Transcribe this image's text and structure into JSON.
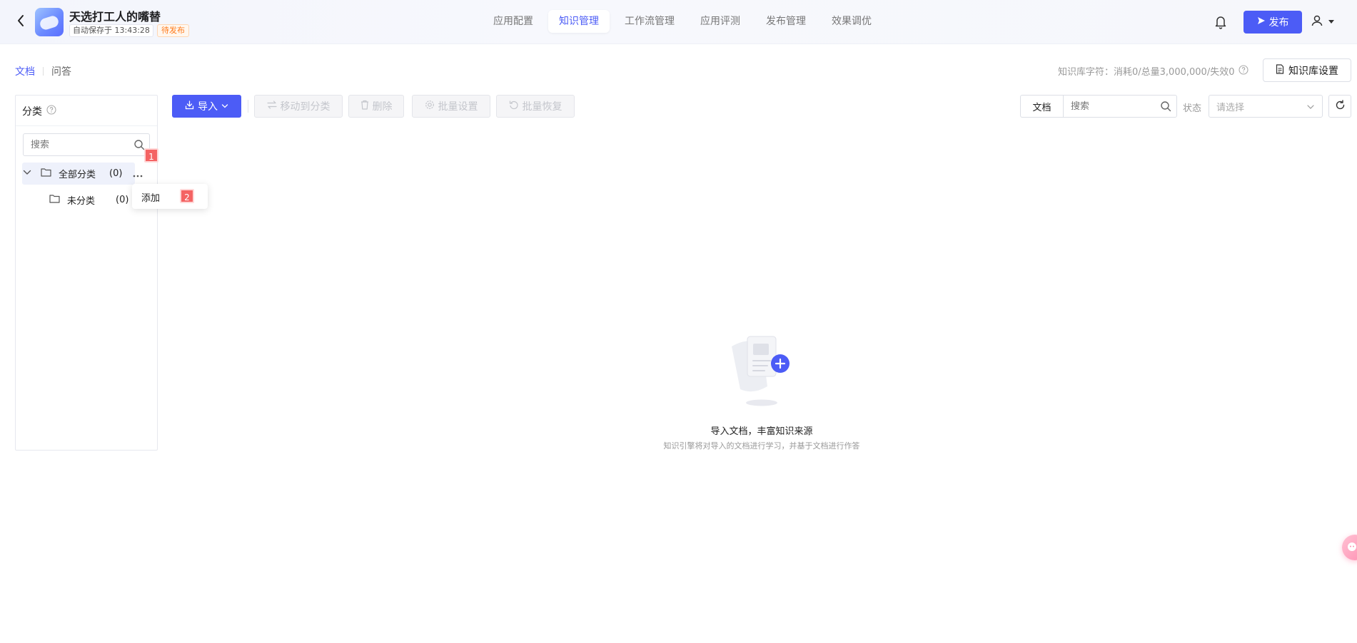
{
  "header": {
    "app_name": "天选打工人的嘴替",
    "autosave": "自动保存于 13:43:28",
    "status": "待发布",
    "nav_tabs": [
      {
        "label": "应用配置"
      },
      {
        "label": "知识管理"
      },
      {
        "label": "工作流管理"
      },
      {
        "label": "应用评测"
      },
      {
        "label": "发布管理"
      },
      {
        "label": "效果调优"
      }
    ],
    "active_tab": "知识管理",
    "publish_label": "发布",
    "accent_color": "#4c5cf6"
  },
  "subtabs": {
    "documents": "文档",
    "qa": "问答"
  },
  "quota": {
    "text": "知识库字符：消耗0/总量3,000,000/失效0"
  },
  "kb_settings_label": "知识库设置",
  "sidebar": {
    "title": "分类",
    "search_placeholder": "搜索",
    "tree": {
      "all_label": "全部分类",
      "all_count": "(0)",
      "uncategorized_label": "未分类",
      "uncategorized_count": "(0)"
    },
    "context_menu": {
      "add_label": "添加"
    }
  },
  "markers": {
    "one": "1",
    "two": "2"
  },
  "toolbar": {
    "import_label": "导入",
    "move_label": "移动到分类",
    "delete_label": "删除",
    "batch_settings_label": "批量设置",
    "batch_restore_label": "批量恢复"
  },
  "filters": {
    "type_label": "文档",
    "search_placeholder": "搜索",
    "status_label": "状态",
    "status_placeholder": "请选择"
  },
  "empty_state": {
    "title": "导入文档，丰富知识来源",
    "description": "知识引擎将对导入的文档进行学习，并基于文档进行作答"
  }
}
